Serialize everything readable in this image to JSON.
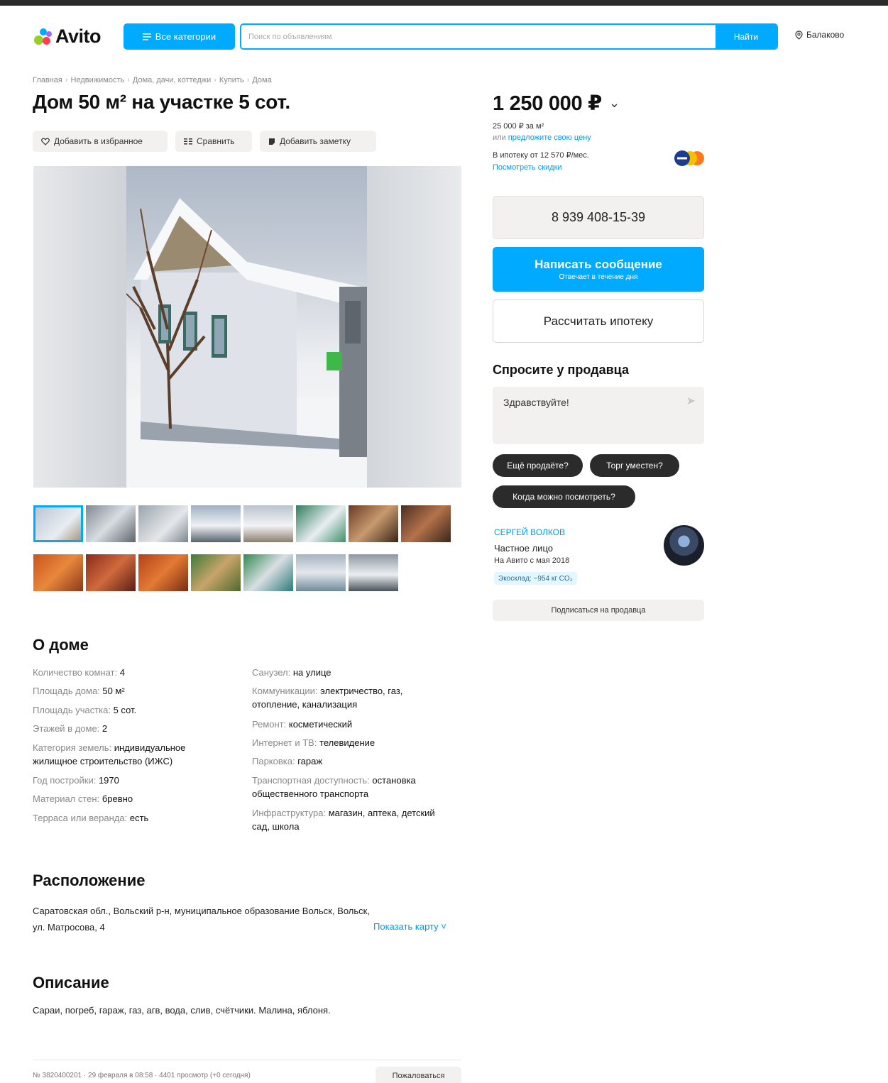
{
  "header": {
    "logo_text": "Avito",
    "categories_button": "Все категории",
    "search_placeholder": "Поиск по объявлениям",
    "search_button": "Найти",
    "location": "Балаково"
  },
  "breadcrumbs": [
    "Главная",
    "Недвижимость",
    "Дома, дачи, коттеджи",
    "Купить",
    "Дома"
  ],
  "listing": {
    "title": "Дом 50 м² на участке 5 сот.",
    "actions": {
      "favorite": "Добавить в избранное",
      "compare": "Сравнить",
      "note": "Добавить заметку"
    },
    "thumbnail_count": 15
  },
  "price": {
    "value": "1 250 000 ₽",
    "per_meter": "25 000 ₽ за м²",
    "offer_prefix": "или",
    "offer_link": "предложите свою цену",
    "mortgage": "В ипотеку от 12 570 ₽/мес.",
    "discount_link": "Посмотреть скидки"
  },
  "contact": {
    "phone": "8 939 408-15-39",
    "message_button": "Написать сообщение",
    "message_sub": "Отвечает в течение дня",
    "mortgage_button": "Рассчитать ипотеку"
  },
  "ask": {
    "title": "Спросите у продавца",
    "input_value": "Здравствуйте!",
    "chips": [
      "Ещё продаёте?",
      "Торг уместен?",
      "Когда можно посмотреть?"
    ]
  },
  "seller": {
    "name": "СЕРГЕЙ ВОЛКОВ",
    "type": "Частное лицо",
    "since": "На Авито с мая 2018",
    "eco": "Экосклад: −954 кг CO₂",
    "subscribe": "Подписаться на продавца"
  },
  "about": {
    "title": "О доме",
    "left": [
      {
        "k": "Количество комнат: ",
        "v": "4"
      },
      {
        "k": "Площадь дома: ",
        "v": "50 м²"
      },
      {
        "k": "Площадь участка: ",
        "v": "5 сот."
      },
      {
        "k": "Этажей в доме: ",
        "v": "2"
      },
      {
        "k": "Категория земель: ",
        "v": "индивидуальное жилищное строительство (ИЖС)"
      },
      {
        "k": "Год постройки: ",
        "v": "1970"
      },
      {
        "k": "Материал стен: ",
        "v": "бревно"
      },
      {
        "k": "Терраса или веранда: ",
        "v": "есть"
      }
    ],
    "right": [
      {
        "k": "Санузел: ",
        "v": "на улице"
      },
      {
        "k": "Коммуникации: ",
        "v": "электричество, газ, отопление, канализация"
      },
      {
        "k": "Ремонт: ",
        "v": "косметический"
      },
      {
        "k": "Интернет и ТВ: ",
        "v": "телевидение"
      },
      {
        "k": "Парковка: ",
        "v": "гараж"
      },
      {
        "k": "Транспортная доступность: ",
        "v": "остановка общественного транспорта"
      },
      {
        "k": "Инфраструктура: ",
        "v": "магазин, аптека, детский сад, школа"
      }
    ]
  },
  "location": {
    "title": "Расположение",
    "address": "Саратовская обл., Вольский р-н, муниципальное образование Вольск, Вольск, ул. Матросова, 4",
    "map_link": "Показать карту ˅"
  },
  "description": {
    "title": "Описание",
    "text": "Сараи, погреб, гараж, газ, агв, вода, слив, счётчики. Малина, яблоня."
  },
  "footer": {
    "meta": "№ 3820400201 · 29 февраля в 08:58 · 4401 просмотр (+0 сегодня)",
    "report": "Пожаловаться"
  },
  "colors": {
    "accent": "#00aaff",
    "link": "#0099f7",
    "chip": "#2b2b2b",
    "surface": "#f2f1f0"
  }
}
